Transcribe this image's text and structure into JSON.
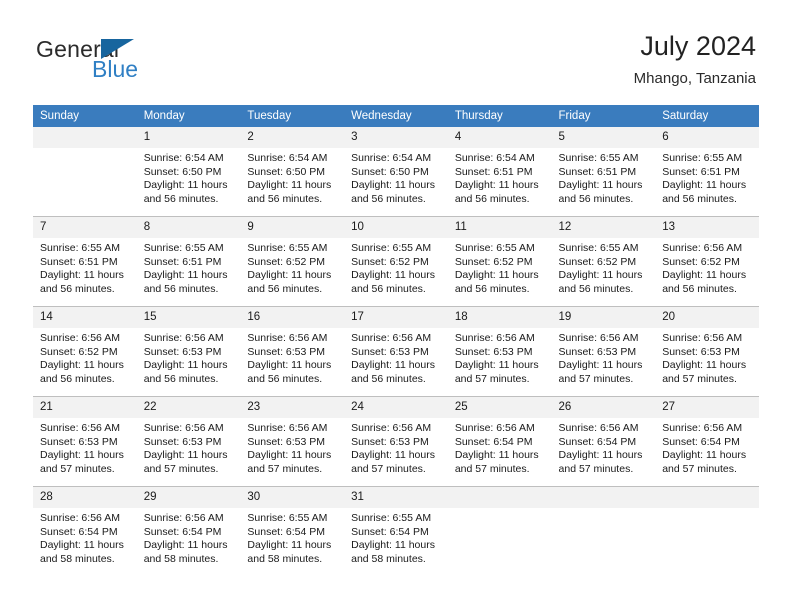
{
  "brand": {
    "name_top": "General",
    "name_bottom": "Blue",
    "accent_color": "#17659e",
    "accent_light": "#2f7fc4"
  },
  "header": {
    "title": "July 2024",
    "location": "Mhango, Tanzania"
  },
  "calendar": {
    "header_color": "#3a7cbe",
    "daynum_bg": "#f2f2f2",
    "weekdays": [
      "Sunday",
      "Monday",
      "Tuesday",
      "Wednesday",
      "Thursday",
      "Friday",
      "Saturday"
    ],
    "weeks": [
      [
        {
          "day": "",
          "sunrise": "",
          "sunset": "",
          "daylight_1": "",
          "daylight_2": ""
        },
        {
          "day": "1",
          "sunrise": "Sunrise: 6:54 AM",
          "sunset": "Sunset: 6:50 PM",
          "daylight_1": "Daylight: 11 hours",
          "daylight_2": "and 56 minutes."
        },
        {
          "day": "2",
          "sunrise": "Sunrise: 6:54 AM",
          "sunset": "Sunset: 6:50 PM",
          "daylight_1": "Daylight: 11 hours",
          "daylight_2": "and 56 minutes."
        },
        {
          "day": "3",
          "sunrise": "Sunrise: 6:54 AM",
          "sunset": "Sunset: 6:50 PM",
          "daylight_1": "Daylight: 11 hours",
          "daylight_2": "and 56 minutes."
        },
        {
          "day": "4",
          "sunrise": "Sunrise: 6:54 AM",
          "sunset": "Sunset: 6:51 PM",
          "daylight_1": "Daylight: 11 hours",
          "daylight_2": "and 56 minutes."
        },
        {
          "day": "5",
          "sunrise": "Sunrise: 6:55 AM",
          "sunset": "Sunset: 6:51 PM",
          "daylight_1": "Daylight: 11 hours",
          "daylight_2": "and 56 minutes."
        },
        {
          "day": "6",
          "sunrise": "Sunrise: 6:55 AM",
          "sunset": "Sunset: 6:51 PM",
          "daylight_1": "Daylight: 11 hours",
          "daylight_2": "and 56 minutes."
        }
      ],
      [
        {
          "day": "7",
          "sunrise": "Sunrise: 6:55 AM",
          "sunset": "Sunset: 6:51 PM",
          "daylight_1": "Daylight: 11 hours",
          "daylight_2": "and 56 minutes."
        },
        {
          "day": "8",
          "sunrise": "Sunrise: 6:55 AM",
          "sunset": "Sunset: 6:51 PM",
          "daylight_1": "Daylight: 11 hours",
          "daylight_2": "and 56 minutes."
        },
        {
          "day": "9",
          "sunrise": "Sunrise: 6:55 AM",
          "sunset": "Sunset: 6:52 PM",
          "daylight_1": "Daylight: 11 hours",
          "daylight_2": "and 56 minutes."
        },
        {
          "day": "10",
          "sunrise": "Sunrise: 6:55 AM",
          "sunset": "Sunset: 6:52 PM",
          "daylight_1": "Daylight: 11 hours",
          "daylight_2": "and 56 minutes."
        },
        {
          "day": "11",
          "sunrise": "Sunrise: 6:55 AM",
          "sunset": "Sunset: 6:52 PM",
          "daylight_1": "Daylight: 11 hours",
          "daylight_2": "and 56 minutes."
        },
        {
          "day": "12",
          "sunrise": "Sunrise: 6:55 AM",
          "sunset": "Sunset: 6:52 PM",
          "daylight_1": "Daylight: 11 hours",
          "daylight_2": "and 56 minutes."
        },
        {
          "day": "13",
          "sunrise": "Sunrise: 6:56 AM",
          "sunset": "Sunset: 6:52 PM",
          "daylight_1": "Daylight: 11 hours",
          "daylight_2": "and 56 minutes."
        }
      ],
      [
        {
          "day": "14",
          "sunrise": "Sunrise: 6:56 AM",
          "sunset": "Sunset: 6:52 PM",
          "daylight_1": "Daylight: 11 hours",
          "daylight_2": "and 56 minutes."
        },
        {
          "day": "15",
          "sunrise": "Sunrise: 6:56 AM",
          "sunset": "Sunset: 6:53 PM",
          "daylight_1": "Daylight: 11 hours",
          "daylight_2": "and 56 minutes."
        },
        {
          "day": "16",
          "sunrise": "Sunrise: 6:56 AM",
          "sunset": "Sunset: 6:53 PM",
          "daylight_1": "Daylight: 11 hours",
          "daylight_2": "and 56 minutes."
        },
        {
          "day": "17",
          "sunrise": "Sunrise: 6:56 AM",
          "sunset": "Sunset: 6:53 PM",
          "daylight_1": "Daylight: 11 hours",
          "daylight_2": "and 56 minutes."
        },
        {
          "day": "18",
          "sunrise": "Sunrise: 6:56 AM",
          "sunset": "Sunset: 6:53 PM",
          "daylight_1": "Daylight: 11 hours",
          "daylight_2": "and 57 minutes."
        },
        {
          "day": "19",
          "sunrise": "Sunrise: 6:56 AM",
          "sunset": "Sunset: 6:53 PM",
          "daylight_1": "Daylight: 11 hours",
          "daylight_2": "and 57 minutes."
        },
        {
          "day": "20",
          "sunrise": "Sunrise: 6:56 AM",
          "sunset": "Sunset: 6:53 PM",
          "daylight_1": "Daylight: 11 hours",
          "daylight_2": "and 57 minutes."
        }
      ],
      [
        {
          "day": "21",
          "sunrise": "Sunrise: 6:56 AM",
          "sunset": "Sunset: 6:53 PM",
          "daylight_1": "Daylight: 11 hours",
          "daylight_2": "and 57 minutes."
        },
        {
          "day": "22",
          "sunrise": "Sunrise: 6:56 AM",
          "sunset": "Sunset: 6:53 PM",
          "daylight_1": "Daylight: 11 hours",
          "daylight_2": "and 57 minutes."
        },
        {
          "day": "23",
          "sunrise": "Sunrise: 6:56 AM",
          "sunset": "Sunset: 6:53 PM",
          "daylight_1": "Daylight: 11 hours",
          "daylight_2": "and 57 minutes."
        },
        {
          "day": "24",
          "sunrise": "Sunrise: 6:56 AM",
          "sunset": "Sunset: 6:53 PM",
          "daylight_1": "Daylight: 11 hours",
          "daylight_2": "and 57 minutes."
        },
        {
          "day": "25",
          "sunrise": "Sunrise: 6:56 AM",
          "sunset": "Sunset: 6:54 PM",
          "daylight_1": "Daylight: 11 hours",
          "daylight_2": "and 57 minutes."
        },
        {
          "day": "26",
          "sunrise": "Sunrise: 6:56 AM",
          "sunset": "Sunset: 6:54 PM",
          "daylight_1": "Daylight: 11 hours",
          "daylight_2": "and 57 minutes."
        },
        {
          "day": "27",
          "sunrise": "Sunrise: 6:56 AM",
          "sunset": "Sunset: 6:54 PM",
          "daylight_1": "Daylight: 11 hours",
          "daylight_2": "and 57 minutes."
        }
      ],
      [
        {
          "day": "28",
          "sunrise": "Sunrise: 6:56 AM",
          "sunset": "Sunset: 6:54 PM",
          "daylight_1": "Daylight: 11 hours",
          "daylight_2": "and 58 minutes."
        },
        {
          "day": "29",
          "sunrise": "Sunrise: 6:56 AM",
          "sunset": "Sunset: 6:54 PM",
          "daylight_1": "Daylight: 11 hours",
          "daylight_2": "and 58 minutes."
        },
        {
          "day": "30",
          "sunrise": "Sunrise: 6:55 AM",
          "sunset": "Sunset: 6:54 PM",
          "daylight_1": "Daylight: 11 hours",
          "daylight_2": "and 58 minutes."
        },
        {
          "day": "31",
          "sunrise": "Sunrise: 6:55 AM",
          "sunset": "Sunset: 6:54 PM",
          "daylight_1": "Daylight: 11 hours",
          "daylight_2": "and 58 minutes."
        },
        {
          "day": "",
          "sunrise": "",
          "sunset": "",
          "daylight_1": "",
          "daylight_2": ""
        },
        {
          "day": "",
          "sunrise": "",
          "sunset": "",
          "daylight_1": "",
          "daylight_2": ""
        },
        {
          "day": "",
          "sunrise": "",
          "sunset": "",
          "daylight_1": "",
          "daylight_2": ""
        }
      ]
    ]
  }
}
